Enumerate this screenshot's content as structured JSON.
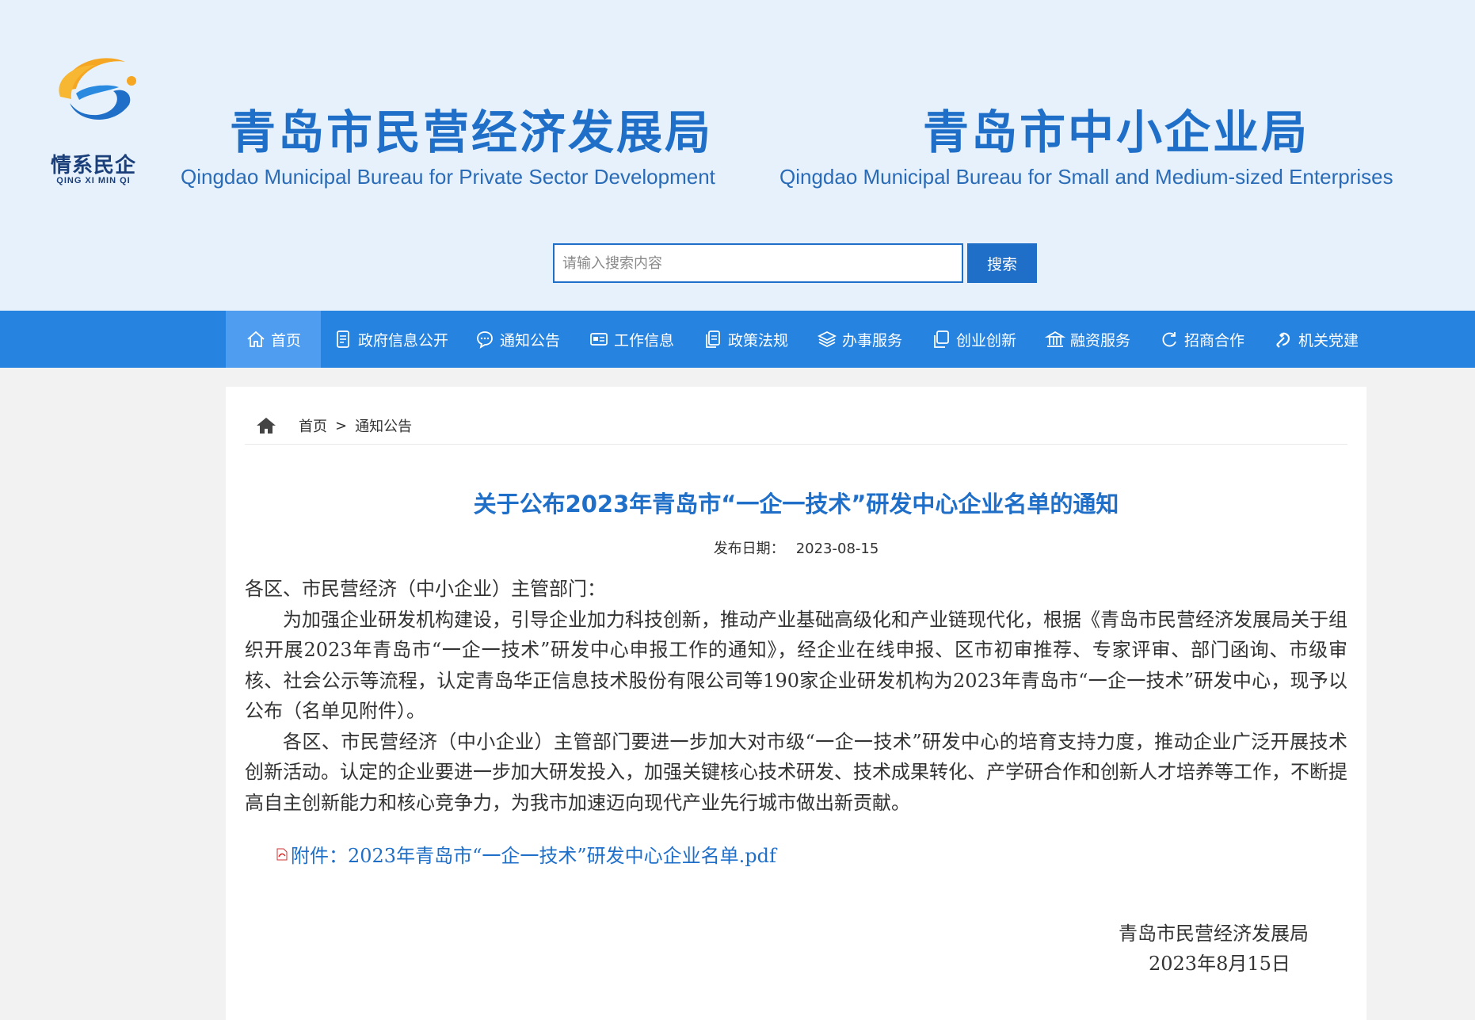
{
  "header": {
    "logo": {
      "cn": "情系民企",
      "en": "QING XI MIN QI",
      "colors": {
        "orange": "#f5a623",
        "blue": "#1f6fc8"
      }
    },
    "bureau1": {
      "cn": "青岛市民营经济发展局",
      "en": "Qingdao Municipal Bureau for Private Sector Development"
    },
    "bureau2": {
      "cn": "青岛市中小企业局",
      "en": "Qingdao Municipal Bureau for Small and Medium-sized Enterprises"
    },
    "search": {
      "placeholder": "请输入搜索内容",
      "value": "",
      "button": "搜索"
    }
  },
  "nav": {
    "items": [
      {
        "label": "首页",
        "icon": "home-icon",
        "active": true
      },
      {
        "label": "政府信息公开",
        "icon": "document-icon",
        "active": false
      },
      {
        "label": "通知公告",
        "icon": "chat-icon",
        "active": false
      },
      {
        "label": "工作信息",
        "icon": "card-icon",
        "active": false
      },
      {
        "label": "政策法规",
        "icon": "pages-icon",
        "active": false
      },
      {
        "label": "办事服务",
        "icon": "layers-icon",
        "active": false
      },
      {
        "label": "创业创新",
        "icon": "copy-icon",
        "active": false
      },
      {
        "label": "融资服务",
        "icon": "building-icon",
        "active": false
      },
      {
        "label": "招商合作",
        "icon": "refresh-icon",
        "active": false
      },
      {
        "label": "机关党建",
        "icon": "party-icon",
        "active": false
      }
    ],
    "colors": {
      "bg": "#2683e0",
      "active": "#4f9df0"
    }
  },
  "breadcrumb": {
    "home": "首页",
    "separator": ">",
    "current": "通知公告"
  },
  "article": {
    "title": "关于公布2023年青岛市“一企一技术”研发中心企业名单的通知",
    "date_label": "发布日期：",
    "date": "2023-08-15",
    "salutation": "各区、市民营经济（中小企业）主管部门：",
    "paragraphs": [
      "为加强企业研发机构建设，引导企业加力科技创新，推动产业基础高级化和产业链现代化，根据《青岛市民营经济发展局关于组织开展2023年青岛市“一企一技术”研发中心申报工作的通知》，经企业在线申报、区市初审推荐、专家评审、部门函询、市级审核、社会公示等流程，认定青岛华正信息技术股份有限公司等190家企业研发机构为2023年青岛市“一企一技术”研发中心，现予以公布（名单见附件）。",
      "各区、市民营经济（中小企业）主管部门要进一步加大对市级“一企一技术”研发中心的培育支持力度，推动企业广泛开展技术创新活动。认定的企业要进一步加大研发投入，加强关键核心技术研发、技术成果转化、产学研合作和创新人才培养等工作，不断提高自主创新能力和核心竞争力，为我市加速迈向现代产业先行城市做出新贡献。"
    ],
    "attachment": "附件：2023年青岛市“一企一技术”研发中心企业名单.pdf",
    "signature_org": "青岛市民营经济发展局",
    "signature_date": "2023年8月15日"
  }
}
